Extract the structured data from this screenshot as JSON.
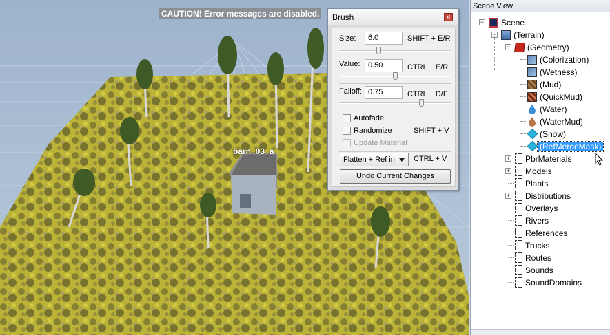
{
  "viewport": {
    "caution_text": "CAUTION! Error messages are disabled.",
    "object_label": "barn_03_a"
  },
  "brush": {
    "title": "Brush",
    "size": {
      "label": "Size:",
      "value": "6.0",
      "shortcut": "SHIFT + E/R",
      "slider": 0.35
    },
    "value": {
      "label": "Value:",
      "value": "0.50",
      "shortcut": "CTRL + E/R",
      "slider": 0.5
    },
    "falloff": {
      "label": "Falloff:",
      "value": "0.75",
      "shortcut": "CTRL + D/F",
      "slider": 0.75
    },
    "autofade": {
      "label": "Autofade",
      "checked": false
    },
    "randomize": {
      "label": "Randomize",
      "checked": false,
      "shortcut": "SHIFT + V"
    },
    "update_material": {
      "label": "Update Material",
      "checked": false,
      "disabled": true
    },
    "mode": {
      "selected": "Flatten + Ref in",
      "shortcut": "CTRL + V"
    },
    "undo_label": "Undo Current Changes"
  },
  "scene_view": {
    "title": "Scene View",
    "nodes": [
      {
        "label": "Scene",
        "icon": "scene-icon",
        "expander": "-"
      },
      {
        "label": "(Terrain)",
        "icon": "terrain-icon",
        "expander": "-"
      },
      {
        "label": "(Geometry)",
        "icon": "geometry-cube-icon",
        "expander": "-"
      },
      {
        "label": "(Colorization)",
        "icon": "texture-icon"
      },
      {
        "label": "(Wetness)",
        "icon": "texture-icon"
      },
      {
        "label": "(Mud)",
        "icon": "mud-texture-icon"
      },
      {
        "label": "(QuickMud)",
        "icon": "quickmud-texture-icon"
      },
      {
        "label": "(Water)",
        "icon": "blue-drop-icon"
      },
      {
        "label": "(WaterMud)",
        "icon": "brown-drop-icon"
      },
      {
        "label": "(Snow)",
        "icon": "diamond-icon"
      },
      {
        "label": "(RefMergeMask)",
        "icon": "diamond-icon",
        "selected": true
      },
      {
        "label": "PbrMaterials",
        "icon": "folder-icon",
        "expander": "+"
      },
      {
        "label": "Models",
        "icon": "folder-icon",
        "expander": "+"
      },
      {
        "label": "Plants",
        "icon": "folder-icon"
      },
      {
        "label": "Distributions",
        "icon": "folder-icon",
        "expander": "+"
      },
      {
        "label": "Overlays",
        "icon": "folder-icon"
      },
      {
        "label": "Rivers",
        "icon": "folder-icon"
      },
      {
        "label": "References",
        "icon": "folder-icon"
      },
      {
        "label": "Trucks",
        "icon": "folder-icon"
      },
      {
        "label": "Routes",
        "icon": "folder-icon"
      },
      {
        "label": "Sounds",
        "icon": "folder-icon"
      },
      {
        "label": "SoundDomains",
        "icon": "folder-icon"
      }
    ]
  },
  "colors": {
    "terrain": "#c8c040",
    "sky": "#a9bdd3",
    "selection": "#3399ff"
  }
}
